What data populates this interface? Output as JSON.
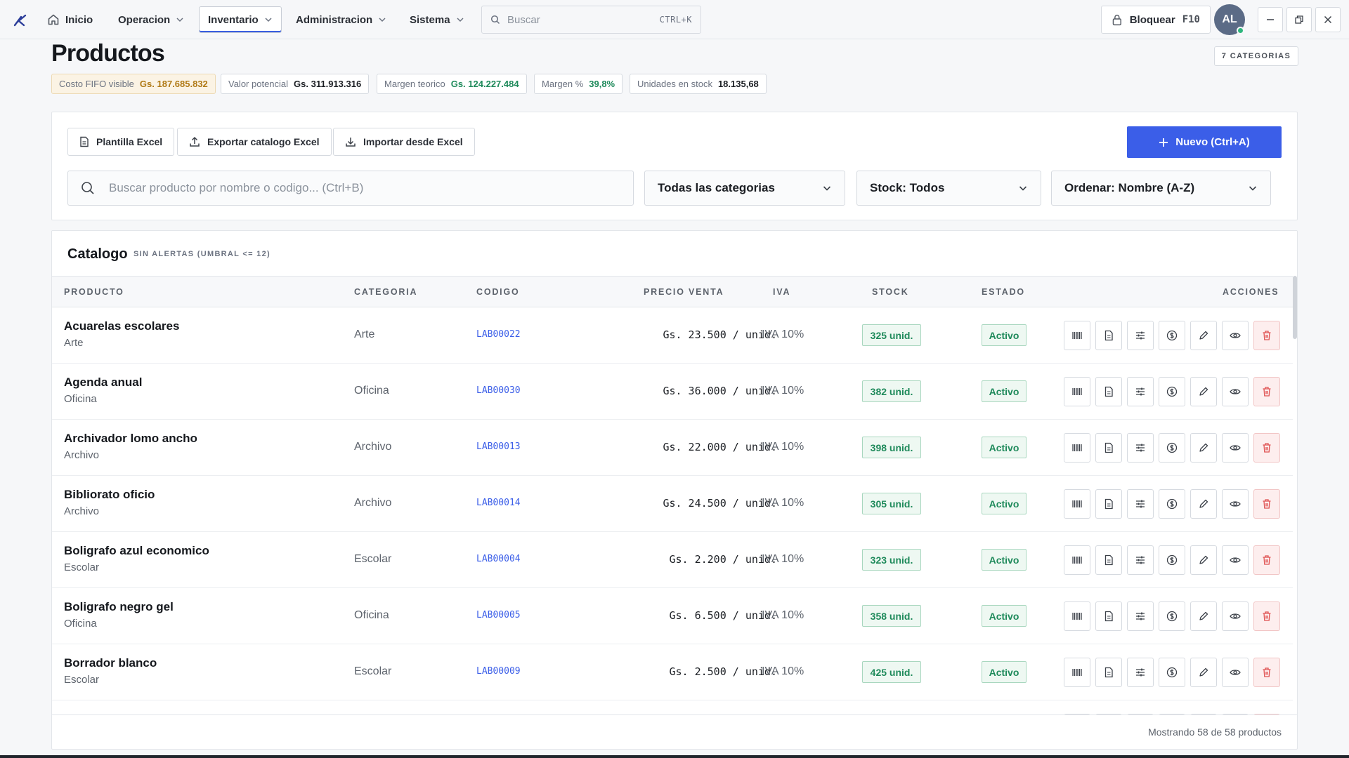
{
  "nav": {
    "items": [
      {
        "label": "Inicio",
        "icon": "home-icon",
        "dropdown": false
      },
      {
        "label": "Operacion",
        "dropdown": true
      },
      {
        "label": "Inventario",
        "dropdown": true,
        "active": true
      },
      {
        "label": "Administracion",
        "dropdown": true
      },
      {
        "label": "Sistema",
        "dropdown": true
      }
    ],
    "search": {
      "placeholder": "Buscar",
      "shortcut": "CTRL+K"
    },
    "lock": {
      "label": "Bloquear",
      "shortcut": "F10"
    },
    "avatar": "AL"
  },
  "header": {
    "title": "Productos",
    "categories_chip": "7 CATEGORIAS",
    "kpis": [
      {
        "label": "Costo FIFO visible",
        "value": "Gs. 187.685.832"
      },
      {
        "label": "Valor potencial",
        "value": "Gs. 311.913.316"
      },
      {
        "label": "Margen teorico",
        "value": "Gs. 124.227.484"
      },
      {
        "label": "Margen %",
        "value": "39,8%"
      },
      {
        "label": "Unidades en stock",
        "value": "18.135,68"
      }
    ]
  },
  "toolbar": {
    "template_btn": "Plantilla Excel",
    "export_btn": "Exportar catalogo Excel",
    "import_btn": "Importar desde Excel",
    "new_btn": "Nuevo (Ctrl+A)",
    "search_placeholder": "Buscar producto por nombre o codigo... (Ctrl+B)",
    "filter_category": "Todas las categorias",
    "filter_stock": "Stock: Todos",
    "sort": "Ordenar: Nombre (A-Z)"
  },
  "catalog": {
    "title": "Catalogo",
    "subtitle": "SIN ALERTAS (UMBRAL <= 12)",
    "columns": {
      "producto": "PRODUCTO",
      "categoria": "CATEGORIA",
      "codigo": "CODIGO",
      "precio": "PRECIO VENTA",
      "iva": "IVA",
      "stock": "STOCK",
      "estado": "ESTADO",
      "acciones": "ACCIONES"
    },
    "rows": [
      {
        "name": "Acuarelas escolares",
        "category": "Arte",
        "code": "LAB00022",
        "price": "Gs. 23.500 / unid.",
        "iva": "IVA 10%",
        "stock": "325 unid.",
        "state": "Activo"
      },
      {
        "name": "Agenda anual",
        "category": "Oficina",
        "code": "LAB00030",
        "price": "Gs. 36.000 / unid.",
        "iva": "IVA 10%",
        "stock": "382 unid.",
        "state": "Activo"
      },
      {
        "name": "Archivador lomo ancho",
        "category": "Archivo",
        "code": "LAB00013",
        "price": "Gs. 22.000 / unid.",
        "iva": "IVA 10%",
        "stock": "398 unid.",
        "state": "Activo"
      },
      {
        "name": "Bibliorato oficio",
        "category": "Archivo",
        "code": "LAB00014",
        "price": "Gs. 24.500 / unid.",
        "iva": "IVA 10%",
        "stock": "305 unid.",
        "state": "Activo"
      },
      {
        "name": "Boligrafo azul economico",
        "category": "Escolar",
        "code": "LAB00004",
        "price": "Gs. 2.200 / unid.",
        "iva": "IVA 10%",
        "stock": "323 unid.",
        "state": "Activo"
      },
      {
        "name": "Boligrafo negro gel",
        "category": "Oficina",
        "code": "LAB00005",
        "price": "Gs. 6.500 / unid.",
        "iva": "IVA 10%",
        "stock": "358 unid.",
        "state": "Activo"
      },
      {
        "name": "Borrador blanco",
        "category": "Escolar",
        "code": "LAB00009",
        "price": "Gs. 2.500 / unid.",
        "iva": "IVA 10%",
        "stock": "425 unid.",
        "state": "Activo"
      }
    ],
    "footer": "Mostrando 58 de 58 productos"
  },
  "actions": [
    "barcode-icon",
    "document-icon",
    "sliders-icon",
    "dollar-icon",
    "pencil-icon",
    "eye-icon",
    "trash-icon"
  ],
  "colors": {
    "accent": "#3b5ee8",
    "success": "#1f8a5b",
    "warning": "#b07a16",
    "danger": "#e05252"
  }
}
